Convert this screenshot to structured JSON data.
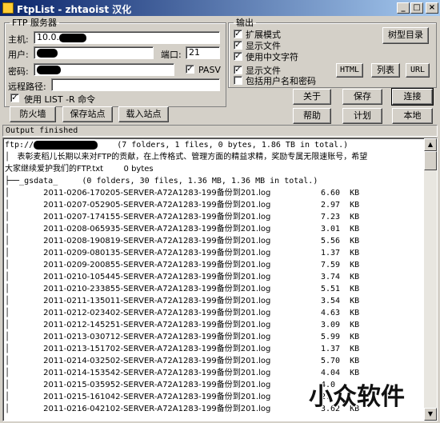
{
  "window": {
    "title": "FtpList - zhtaoist 汉化",
    "buttons": {
      "minimize": "_",
      "maximize": "□",
      "close": "×"
    }
  },
  "server": {
    "group_title": "FTP 服务器",
    "host_label": "主机:",
    "host_value": "10.0.",
    "user_label": "用户:",
    "user_value": "",
    "port_label": "端口:",
    "port_value": "21",
    "password_label": "密码:",
    "password_value": "",
    "pasv_label": "PASV",
    "pasv_checked": true,
    "remote_path_label": "远程路径:",
    "remote_path_value": "",
    "list_r_label": "使用 LIST -R 命令",
    "list_r_checked": true,
    "firewall_button": "防火墙",
    "save_site_button": "保存站点",
    "load_site_button": "载入站点"
  },
  "output": {
    "group_title": "输出",
    "options": [
      {
        "label": "扩展模式",
        "checked": true
      },
      {
        "label": "显示文件",
        "checked": true
      },
      {
        "label": "使用中文字符",
        "checked": true
      }
    ],
    "options2": [
      {
        "label": "显示文件",
        "checked": true
      },
      {
        "label": "包括用户名和密码",
        "checked": false
      }
    ],
    "tree_dir_button": "树型目录",
    "html_button": "HTML",
    "list_button": "列表",
    "url_button": "URL"
  },
  "actions": {
    "about": "关于",
    "save": "保存",
    "connect": "连接",
    "help": "帮助",
    "schedule": "计划",
    "local": "本地"
  },
  "status_text": "Output finished",
  "tree": {
    "root_prefix": "ftp://",
    "root_summary": "(7 folders, 1 files, 0 bytes, 1.86 TB in total.)",
    "notice_line1": "│   表彰麦稻儿长期以来对FTP的贡献，在上传格式、管理方面的精益求精，奖励专属无限速账号，希望",
    "notice_line2": "大家继续爱护我们的FTP.txt        0 bytes",
    "folder_line": "├──_gsdata_     (0 folders, 30 files, 1.36 MB, 1.36 MB in total.)",
    "files": [
      {
        "name": "2011-0206-170205-SERVER-A72A1283-199备份到201.log",
        "size": "6.60  KB"
      },
      {
        "name": "2011-0207-052905-SERVER-A72A1283-199备份到201.log",
        "size": "2.97  KB"
      },
      {
        "name": "2011-0207-174155-SERVER-A72A1283-199备份到201.log",
        "size": "7.23  KB"
      },
      {
        "name": "2011-0208-065935-SERVER-A72A1283-199备份到201.log",
        "size": "3.01  KB"
      },
      {
        "name": "2011-0208-190819-SERVER-A72A1283-199备份到201.log",
        "size": "5.56  KB"
      },
      {
        "name": "2011-0209-080135-SERVER-A72A1283-199备份到201.log",
        "size": "1.37  KB"
      },
      {
        "name": "2011-0209-200855-SERVER-A72A1283-199备份到201.log",
        "size": "7.59  KB"
      },
      {
        "name": "2011-0210-105445-SERVER-A72A1283-199备份到201.log",
        "size": "3.74  KB"
      },
      {
        "name": "2011-0210-233855-SERVER-A72A1283-199备份到201.log",
        "size": "5.51  KB"
      },
      {
        "name": "2011-0211-135011-SERVER-A72A1283-199备份到201.log",
        "size": "3.54  KB"
      },
      {
        "name": "2011-0212-023402-SERVER-A72A1283-199备份到201.log",
        "size": "4.63  KB"
      },
      {
        "name": "2011-0212-145251-SERVER-A72A1283-199备份到201.log",
        "size": "3.09  KB"
      },
      {
        "name": "2011-0213-030712-SERVER-A72A1283-199备份到201.log",
        "size": "5.99  KB"
      },
      {
        "name": "2011-0213-151702-SERVER-A72A1283-199备份到201.log",
        "size": "1.37  KB"
      },
      {
        "name": "2011-0214-032502-SERVER-A72A1283-199备份到201.log",
        "size": "5.70  KB"
      },
      {
        "name": "2011-0214-153542-SERVER-A72A1283-199备份到201.log",
        "size": "4.04  KB"
      },
      {
        "name": "2011-0215-035952-SERVER-A72A1283-199备份到201.log",
        "size": "4.0"
      },
      {
        "name": "2011-0215-161042-SERVER-A72A1283-199备份到201.log",
        "size": "2."
      },
      {
        "name": "2011-0216-042102-SERVER-A72A1283-199备份到201.log",
        "size": "3.62  KB"
      }
    ]
  },
  "watermark": "小众软件"
}
